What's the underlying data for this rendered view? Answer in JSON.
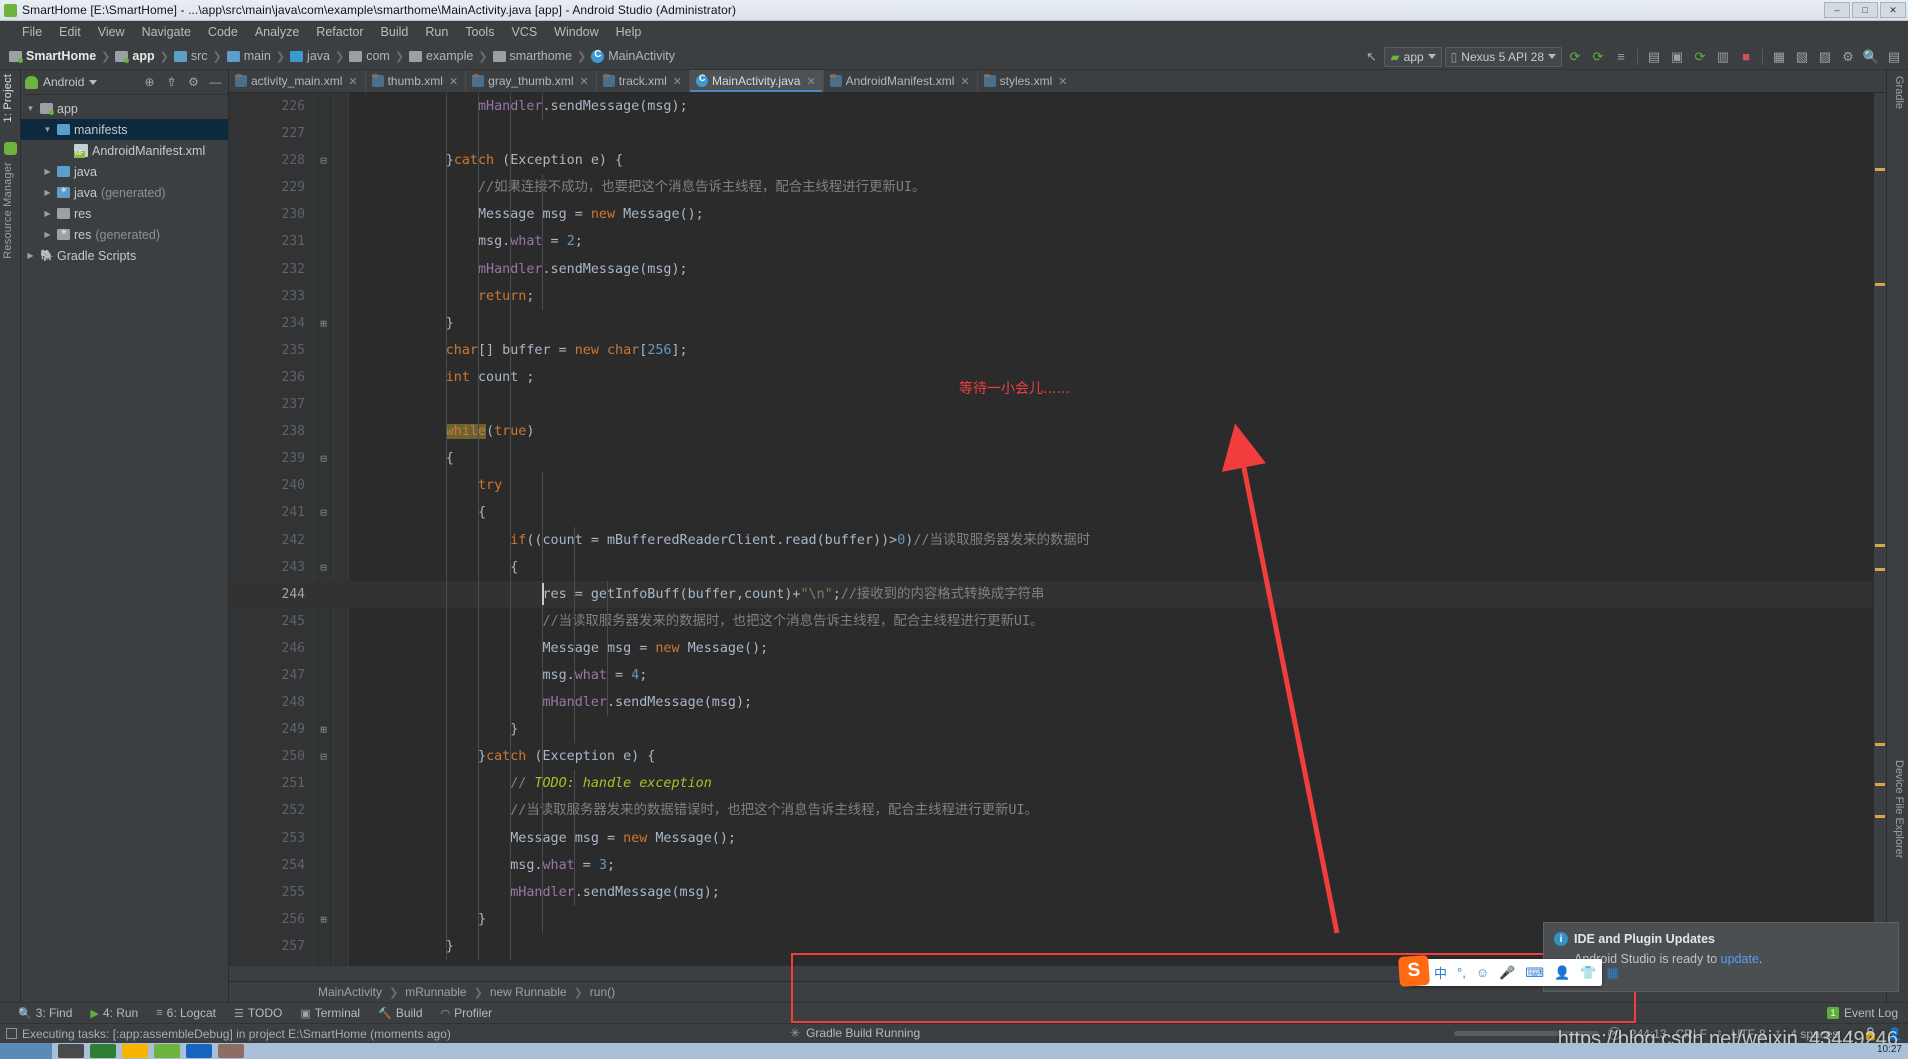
{
  "window": {
    "title": "SmartHome [E:\\SmartHome] - ...\\app\\src\\main\\java\\com\\example\\smarthome\\MainActivity.java [app] - Android Studio (Administrator)",
    "minimize": "–",
    "maximize": "□",
    "close": "✕"
  },
  "menu": [
    "File",
    "Edit",
    "View",
    "Navigate",
    "Code",
    "Analyze",
    "Refactor",
    "Build",
    "Run",
    "Tools",
    "VCS",
    "Window",
    "Help"
  ],
  "breadcrumb": [
    {
      "label": "SmartHome",
      "icon": "module-icon",
      "bold": true
    },
    {
      "label": "app",
      "icon": "module-icon",
      "bold": true
    },
    {
      "label": "src",
      "icon": "folder-icon",
      "bold": false
    },
    {
      "label": "main",
      "icon": "folder-icon",
      "bold": false
    },
    {
      "label": "java",
      "icon": "source-folder-icon",
      "bold": false
    },
    {
      "label": "com",
      "icon": "package-icon",
      "bold": false
    },
    {
      "label": "example",
      "icon": "package-icon",
      "bold": false
    },
    {
      "label": "smarthome",
      "icon": "package-icon",
      "bold": false
    },
    {
      "label": "MainActivity",
      "icon": "class-icon",
      "bold": false
    }
  ],
  "toolbar": {
    "module_selector": "app",
    "device_selector": "Nexus 5 API 28",
    "icons": [
      "back-arrow-icon",
      "run-icon",
      "debug-icon",
      "apply-changes-icon",
      "sync-icon",
      "avd-manager-icon",
      "sdk-manager-icon",
      "stop-icon",
      "profiler-icon",
      "layout-inspector-icon",
      "attach-debugger-icon",
      "search-icon",
      "menu-icon"
    ]
  },
  "project_panel": {
    "title": "Android",
    "header_icons": [
      "target-icon",
      "collapse-all-icon",
      "gear-icon",
      "hide-icon"
    ],
    "tree": [
      {
        "label": "app",
        "depth": 0,
        "arrow": "▼",
        "icon": "module-icon",
        "selected": false
      },
      {
        "label": "manifests",
        "depth": 1,
        "arrow": "▼",
        "icon": "folder-icon",
        "selected": true
      },
      {
        "label": "AndroidManifest.xml",
        "depth": 2,
        "arrow": "",
        "icon": "manifest-icon",
        "selected": false
      },
      {
        "label": "java",
        "depth": 1,
        "arrow": "▶",
        "icon": "folder-icon",
        "selected": false
      },
      {
        "label": "java",
        "suffix": " (generated)",
        "depth": 1,
        "arrow": "▶",
        "icon": "generated-folder-icon",
        "selected": false
      },
      {
        "label": "res",
        "depth": 1,
        "arrow": "▶",
        "icon": "res-folder-icon",
        "selected": false
      },
      {
        "label": "res",
        "suffix": " (generated)",
        "depth": 1,
        "arrow": "▶",
        "icon": "generated-res-icon",
        "selected": false
      },
      {
        "label": "Gradle Scripts",
        "depth": 0,
        "arrow": "▶",
        "icon": "gradle-icon",
        "selected": false
      }
    ]
  },
  "left_strip": [
    "1: Project",
    "Resource Manager"
  ],
  "right_strip": [
    "Gradle",
    "Device File Explorer"
  ],
  "editor_tabs": [
    {
      "label": "activity_main.xml",
      "icon": "xml-icon",
      "active": false
    },
    {
      "label": "thumb.xml",
      "icon": "xml-icon",
      "active": false
    },
    {
      "label": "gray_thumb.xml",
      "icon": "xml-icon",
      "active": false
    },
    {
      "label": "track.xml",
      "icon": "xml-icon",
      "active": false
    },
    {
      "label": "MainActivity.java",
      "icon": "java-class-icon",
      "active": true
    },
    {
      "label": "AndroidManifest.xml",
      "icon": "xml-icon",
      "active": false
    },
    {
      "label": "styles.xml",
      "icon": "xml-icon",
      "active": false
    }
  ],
  "code": {
    "first_line": 226,
    "current_line": 244,
    "lines": [
      {
        "n": 226,
        "fold": "",
        "indent": 6,
        "tokens": [
          {
            "t": "                ",
            "c": "pl"
          },
          {
            "t": "mHandler",
            "c": "fld"
          },
          {
            "t": ".sendMessage(msg)",
            "c": "pl"
          },
          {
            "t": ";",
            "c": "pl"
          }
        ]
      },
      {
        "n": 227,
        "fold": "",
        "indent": 5,
        "tokens": []
      },
      {
        "n": 228,
        "fold": "minus",
        "indent": 5,
        "tokens": [
          {
            "t": "            }",
            "c": "pl"
          },
          {
            "t": "catch",
            "c": "kw"
          },
          {
            "t": " (Exception e) {",
            "c": "pl"
          }
        ]
      },
      {
        "n": 229,
        "fold": "",
        "indent": 6,
        "tokens": [
          {
            "t": "                ",
            "c": "pl"
          },
          {
            "t": "//如果连接不成功，也要把这个消息告诉主线程，配合主线程进行更新UI。",
            "c": "cmt"
          }
        ]
      },
      {
        "n": 230,
        "fold": "",
        "indent": 6,
        "tokens": [
          {
            "t": "                Message msg = ",
            "c": "pl"
          },
          {
            "t": "new",
            "c": "kw"
          },
          {
            "t": " Message();",
            "c": "pl"
          }
        ]
      },
      {
        "n": 231,
        "fold": "",
        "indent": 6,
        "tokens": [
          {
            "t": "                msg.",
            "c": "pl"
          },
          {
            "t": "what",
            "c": "fld"
          },
          {
            "t": " = ",
            "c": "pl"
          },
          {
            "t": "2",
            "c": "num"
          },
          {
            "t": ";",
            "c": "pl"
          }
        ]
      },
      {
        "n": 232,
        "fold": "",
        "indent": 6,
        "tokens": [
          {
            "t": "                ",
            "c": "pl"
          },
          {
            "t": "mHandler",
            "c": "fld"
          },
          {
            "t": ".sendMessage(msg);",
            "c": "pl"
          }
        ]
      },
      {
        "n": 233,
        "fold": "",
        "indent": 6,
        "tokens": [
          {
            "t": "                ",
            "c": "pl"
          },
          {
            "t": "return",
            "c": "kw"
          },
          {
            "t": ";",
            "c": "pl"
          }
        ]
      },
      {
        "n": 234,
        "fold": "plus",
        "indent": 5,
        "tokens": [
          {
            "t": "            }",
            "c": "pl"
          }
        ]
      },
      {
        "n": 235,
        "fold": "",
        "indent": 5,
        "tokens": [
          {
            "t": "            ",
            "c": "pl"
          },
          {
            "t": "char",
            "c": "kw"
          },
          {
            "t": "[] buffer = ",
            "c": "pl"
          },
          {
            "t": "new",
            "c": "kw"
          },
          {
            "t": " ",
            "c": "pl"
          },
          {
            "t": "char",
            "c": "kw"
          },
          {
            "t": "[",
            "c": "pl"
          },
          {
            "t": "256",
            "c": "num"
          },
          {
            "t": "];",
            "c": "pl"
          }
        ]
      },
      {
        "n": 236,
        "fold": "",
        "indent": 5,
        "tokens": [
          {
            "t": "            ",
            "c": "pl"
          },
          {
            "t": "int",
            "c": "kw"
          },
          {
            "t": " count ;",
            "c": "pl"
          }
        ]
      },
      {
        "n": 237,
        "fold": "",
        "indent": 5,
        "tokens": []
      },
      {
        "n": 238,
        "fold": "",
        "indent": 5,
        "tokens": [
          {
            "t": "            ",
            "c": "pl"
          },
          {
            "t": "while",
            "c": "whilehl"
          },
          {
            "t": "(",
            "c": "pl"
          },
          {
            "t": "true",
            "c": "kw"
          },
          {
            "t": ")",
            "c": "pl"
          }
        ]
      },
      {
        "n": 239,
        "fold": "minus",
        "indent": 5,
        "tokens": [
          {
            "t": "            {",
            "c": "pl"
          }
        ]
      },
      {
        "n": 240,
        "fold": "",
        "indent": 6,
        "tokens": [
          {
            "t": "                ",
            "c": "pl"
          },
          {
            "t": "try",
            "c": "kw"
          }
        ]
      },
      {
        "n": 241,
        "fold": "minus",
        "indent": 6,
        "tokens": [
          {
            "t": "                {",
            "c": "pl"
          }
        ]
      },
      {
        "n": 242,
        "fold": "",
        "indent": 7,
        "tokens": [
          {
            "t": "                    ",
            "c": "pl"
          },
          {
            "t": "if",
            "c": "kw"
          },
          {
            "t": "((count = mBufferedReaderClient.read(buffer))>",
            "c": "pl"
          },
          {
            "t": "0",
            "c": "num"
          },
          {
            "t": ")",
            "c": "pl"
          },
          {
            "t": "//当读取服务器发来的数据时",
            "c": "cmt"
          }
        ]
      },
      {
        "n": 243,
        "fold": "minus",
        "indent": 7,
        "tokens": [
          {
            "t": "                    {",
            "c": "pl"
          }
        ]
      },
      {
        "n": 244,
        "fold": "",
        "indent": 8,
        "tokens": [
          {
            "t": "                        res = getInfoBuff(buffer,count)+",
            "c": "pl"
          },
          {
            "t": "\"\\n\"",
            "c": "str"
          },
          {
            "t": ";",
            "c": "pl"
          },
          {
            "t": "//接收到的内容格式转换成字符串",
            "c": "cmt"
          }
        ],
        "current": true
      },
      {
        "n": 245,
        "fold": "",
        "indent": 8,
        "tokens": [
          {
            "t": "                        ",
            "c": "pl"
          },
          {
            "t": "//当读取服务器发来的数据时，也把这个消息告诉主线程，配合主线程进行更新UI。",
            "c": "cmt"
          }
        ]
      },
      {
        "n": 246,
        "fold": "",
        "indent": 8,
        "tokens": [
          {
            "t": "                        Message msg = ",
            "c": "pl"
          },
          {
            "t": "new",
            "c": "kw"
          },
          {
            "t": " Message();",
            "c": "pl"
          }
        ]
      },
      {
        "n": 247,
        "fold": "",
        "indent": 8,
        "tokens": [
          {
            "t": "                        msg.",
            "c": "pl"
          },
          {
            "t": "what",
            "c": "fld"
          },
          {
            "t": " = ",
            "c": "pl"
          },
          {
            "t": "4",
            "c": "num"
          },
          {
            "t": ";",
            "c": "pl"
          }
        ]
      },
      {
        "n": 248,
        "fold": "",
        "indent": 8,
        "tokens": [
          {
            "t": "                        ",
            "c": "pl"
          },
          {
            "t": "mHandler",
            "c": "fld"
          },
          {
            "t": ".sendMessage(msg);",
            "c": "pl"
          }
        ]
      },
      {
        "n": 249,
        "fold": "plus",
        "indent": 7,
        "tokens": [
          {
            "t": "                    }",
            "c": "pl"
          }
        ]
      },
      {
        "n": 250,
        "fold": "minus",
        "indent": 6,
        "tokens": [
          {
            "t": "                }",
            "c": "pl"
          },
          {
            "t": "catch",
            "c": "kw"
          },
          {
            "t": " (Exception e) {",
            "c": "pl"
          }
        ]
      },
      {
        "n": 251,
        "fold": "",
        "indent": 7,
        "tokens": [
          {
            "t": "                    ",
            "c": "pl"
          },
          {
            "t": "// ",
            "c": "cmt"
          },
          {
            "t": "TODO: handle exception",
            "c": "todo"
          }
        ]
      },
      {
        "n": 252,
        "fold": "",
        "indent": 7,
        "tokens": [
          {
            "t": "                    ",
            "c": "pl"
          },
          {
            "t": "//当读取服务器发来的数据错误时，也把这个消息告诉主线程，配合主线程进行更新UI。",
            "c": "cmt"
          }
        ]
      },
      {
        "n": 253,
        "fold": "",
        "indent": 7,
        "tokens": [
          {
            "t": "                    Message msg = ",
            "c": "pl"
          },
          {
            "t": "new",
            "c": "kw"
          },
          {
            "t": " Message();",
            "c": "pl"
          }
        ]
      },
      {
        "n": 254,
        "fold": "",
        "indent": 7,
        "tokens": [
          {
            "t": "                    msg.",
            "c": "pl"
          },
          {
            "t": "what",
            "c": "fld"
          },
          {
            "t": " = ",
            "c": "pl"
          },
          {
            "t": "3",
            "c": "num"
          },
          {
            "t": ";",
            "c": "pl"
          }
        ]
      },
      {
        "n": 255,
        "fold": "",
        "indent": 7,
        "tokens": [
          {
            "t": "                    ",
            "c": "pl"
          },
          {
            "t": "mHandler",
            "c": "fld"
          },
          {
            "t": ".sendMessage(msg);",
            "c": "pl"
          }
        ]
      },
      {
        "n": 256,
        "fold": "plus",
        "indent": 6,
        "tokens": [
          {
            "t": "                }",
            "c": "pl"
          }
        ]
      },
      {
        "n": 257,
        "fold": "",
        "indent": 5,
        "tokens": [
          {
            "t": "            }",
            "c": "pl"
          }
        ]
      }
    ]
  },
  "annotation": {
    "text": "等待一小会儿......",
    "color": "#f23d3d"
  },
  "structure_breadcrumb": [
    "MainActivity",
    "mRunnable",
    "new Runnable",
    "run()"
  ],
  "tool_window_buttons": [
    {
      "label": "3: Find",
      "mnemonic": "3",
      "icon": "search-icon"
    },
    {
      "label": "4: Run",
      "mnemonic": "4",
      "icon": "run-icon"
    },
    {
      "label": "6: Logcat",
      "mnemonic": "6",
      "icon": "logcat-icon"
    },
    {
      "label": "TODO",
      "mnemonic": "",
      "icon": "todo-icon"
    },
    {
      "label": "Terminal",
      "mnemonic": "",
      "icon": "terminal-icon"
    },
    {
      "label": "Build",
      "mnemonic": "",
      "icon": "build-icon"
    },
    {
      "label": "Profiler",
      "mnemonic": "",
      "icon": "profiler-icon"
    }
  ],
  "event_log": {
    "label": "Event Log",
    "badge": "1"
  },
  "status_bar": {
    "message": "Executing tasks: [:app:assembleDebug] in project E:\\SmartHome (moments ago)",
    "gradle_status": "Gradle Build Running",
    "caret_position": "244:13",
    "line_separator": "CRLF",
    "encoding": "UTF-8",
    "indent": "4 spaces",
    "lock_icon": "lock-icon",
    "inspector_icon": "inspector-icon"
  },
  "notification": {
    "title": "IDE and Plugin Updates",
    "body_prefix": "Android Studio is ready to ",
    "link": "update",
    "body_suffix": "."
  },
  "ime_bar": {
    "logo": "S",
    "items": [
      "中",
      "°,",
      "☺",
      "🎤",
      "⌨",
      "👤"
    ]
  },
  "watermark": "https://blog.csdn.net/weixin_43449246",
  "taskbar": {
    "clock": "10:27"
  }
}
